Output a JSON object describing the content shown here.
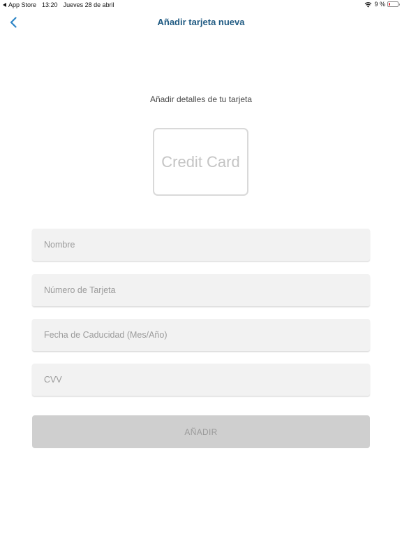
{
  "status_bar": {
    "back_app": "App Store",
    "time": "13:20",
    "date": "Jueves 28 de abril",
    "battery": "9 %",
    "battery_level_percent": 9,
    "battery_color": "#e0303a"
  },
  "nav": {
    "back_icon": "chevron-left-icon",
    "title": "Añadir tarjeta nueva",
    "title_color": "#1f5a82",
    "accent_color": "#2f86c7"
  },
  "main": {
    "section_title": "Añadir detalles de tu tarjeta",
    "card_preview_label": "Credit Card",
    "fields": {
      "name_placeholder": "Nombre",
      "number_placeholder": "Número de Tarjeta",
      "expiry_placeholder": "Fecha de Caducidad (Mes/Año)",
      "cvv_placeholder": "CVV"
    },
    "add_button_label": "AÑADIR",
    "add_button_color": "#cfcfcf"
  }
}
